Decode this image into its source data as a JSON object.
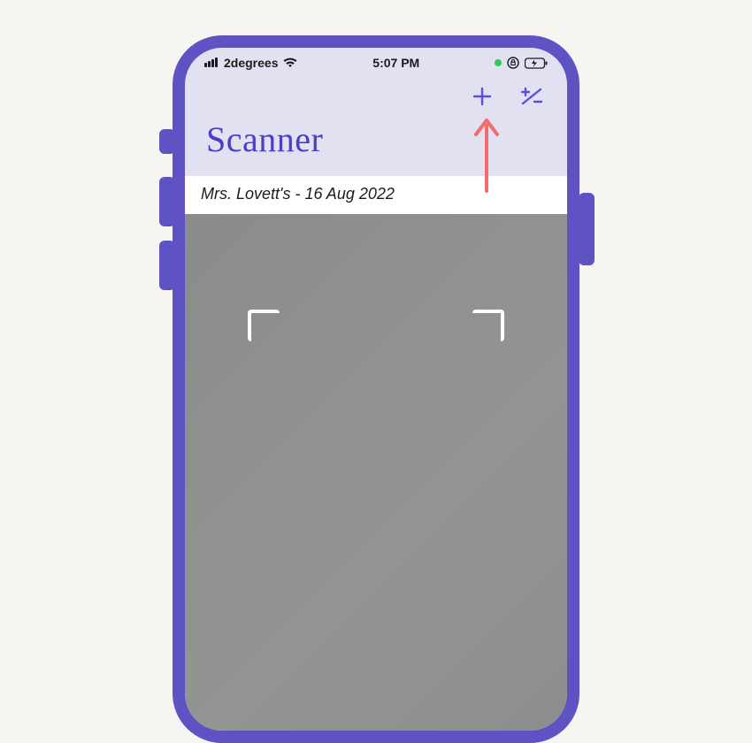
{
  "status_bar": {
    "carrier": "2degrees",
    "time": "5:07 PM"
  },
  "header": {
    "title": "Scanner"
  },
  "actions": {
    "add_label": "+",
    "adjust_label": "+/−"
  },
  "session": {
    "label": "Mrs. Lovett's - 16 Aug 2022"
  },
  "colors": {
    "device_frame": "#5f53c3",
    "header_bg": "#e2e1f2",
    "brand": "#4a3fc7",
    "arrow": "#f26d6d"
  }
}
